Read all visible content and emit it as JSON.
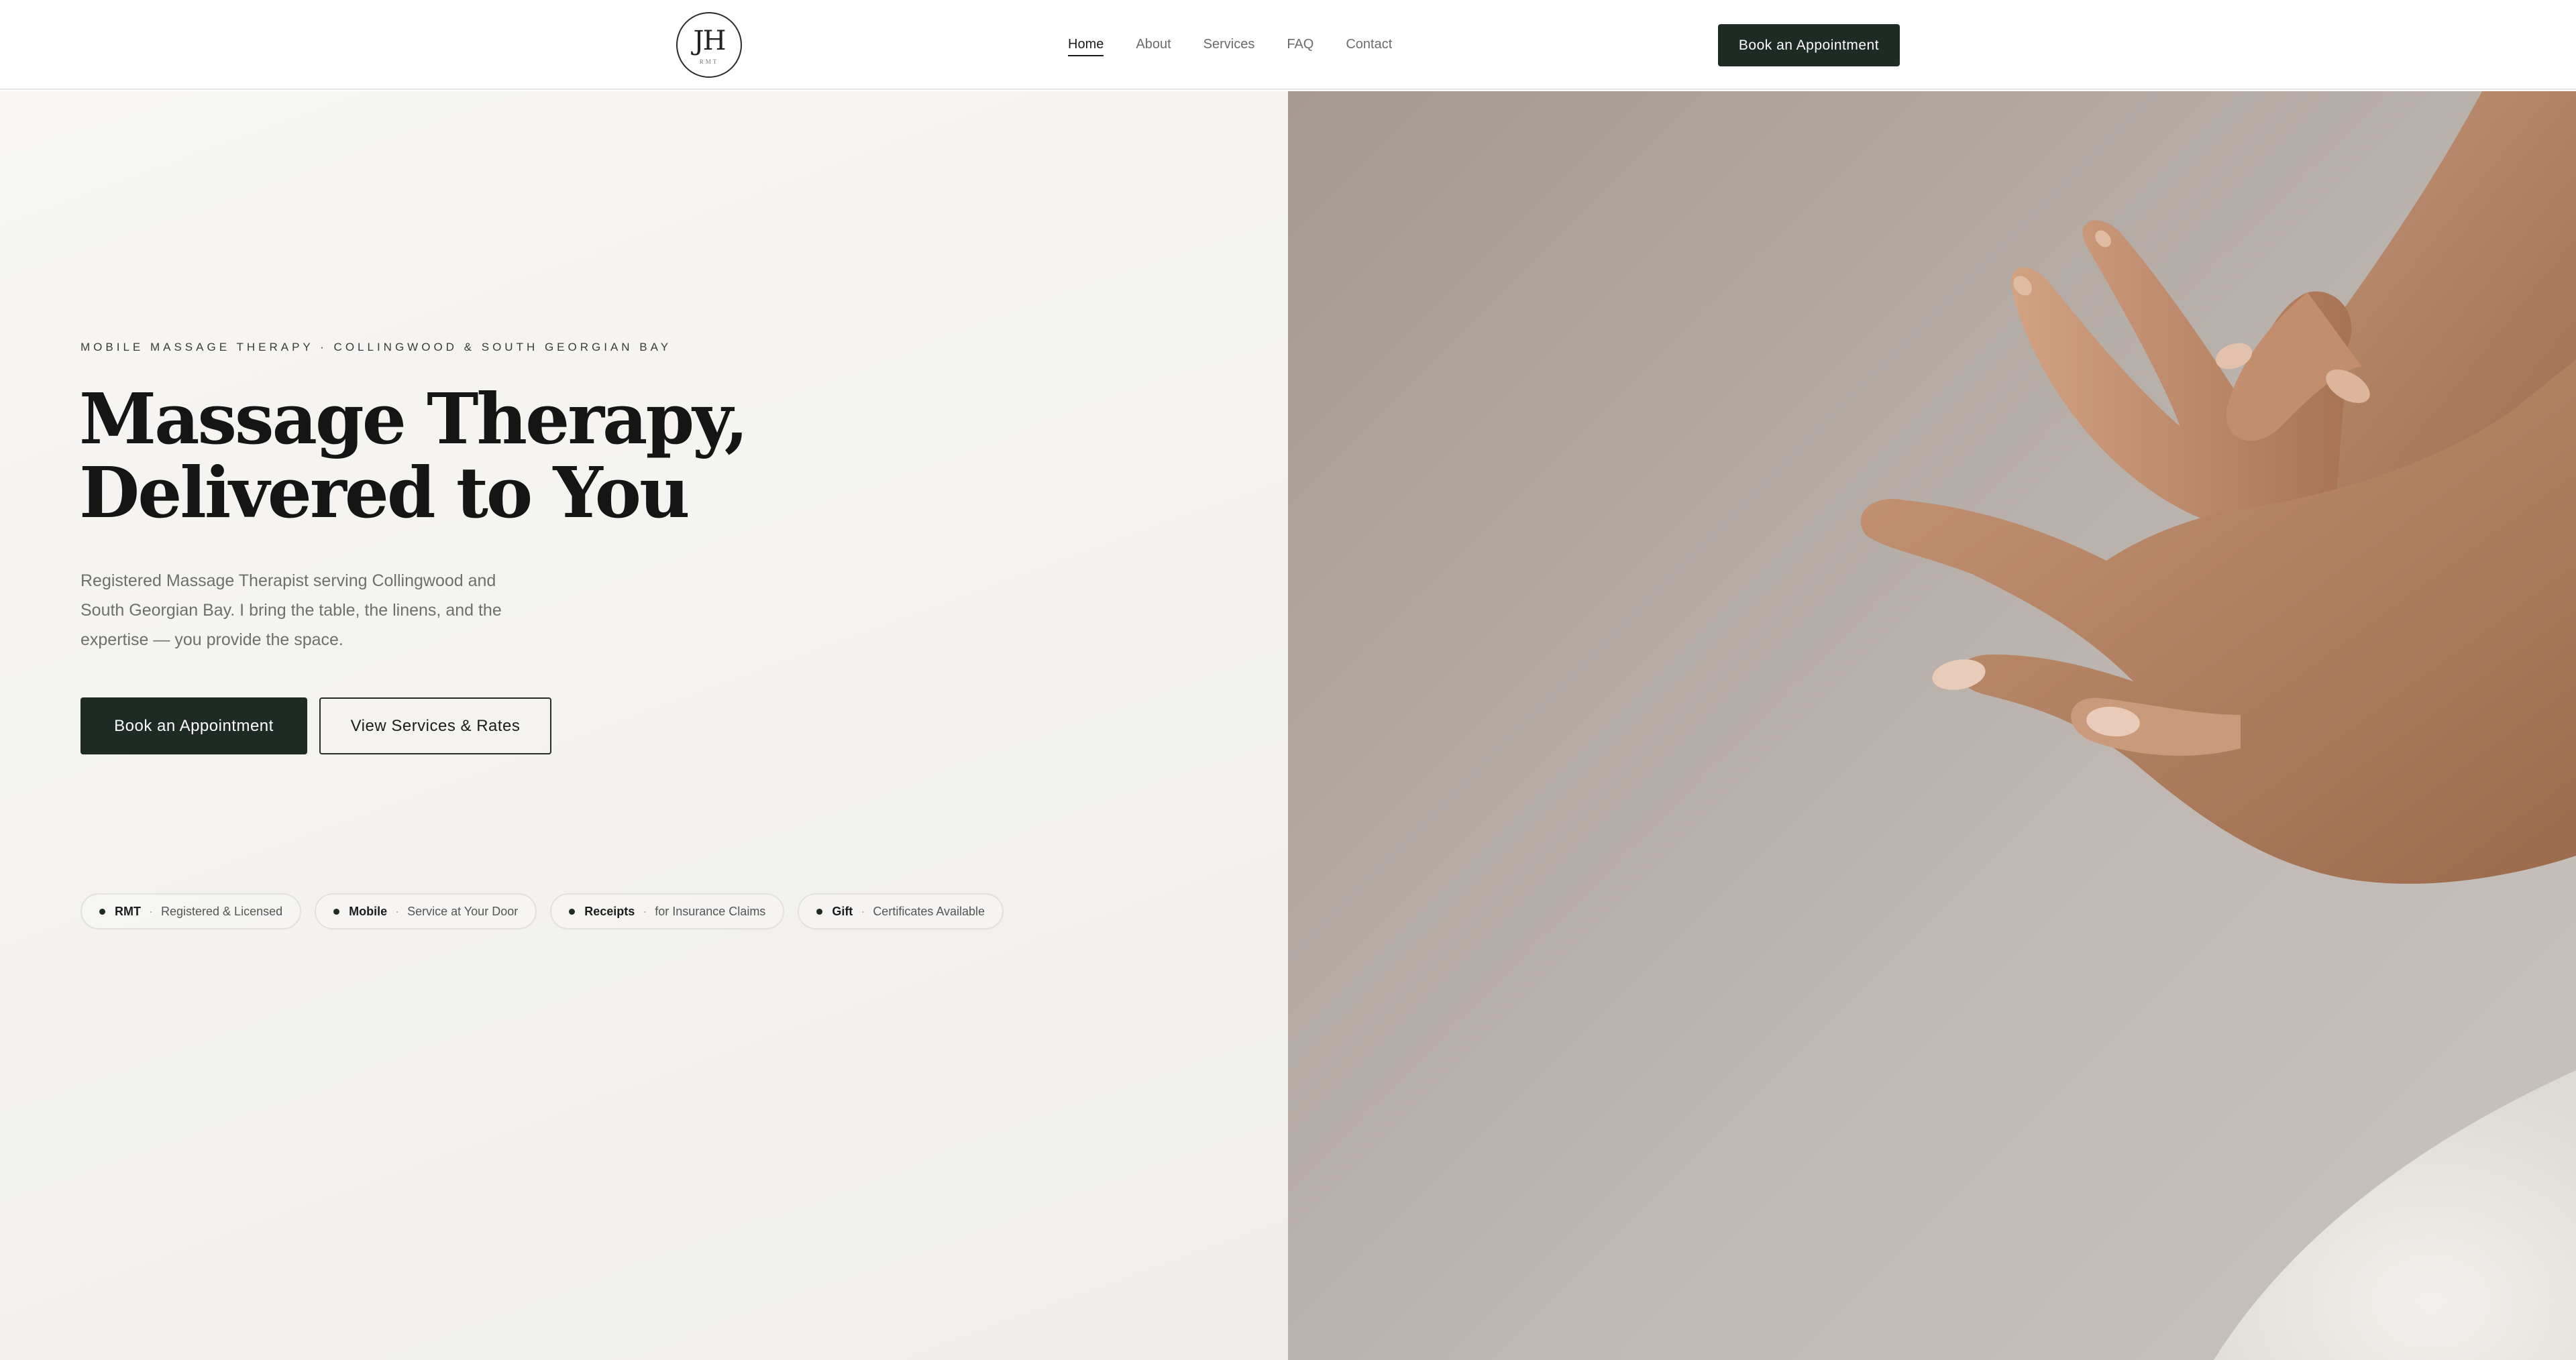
{
  "header": {
    "logo": {
      "monogram": "JH",
      "subtext": "RMT"
    },
    "nav": [
      {
        "label": "Home",
        "active": true
      },
      {
        "label": "About",
        "active": false
      },
      {
        "label": "Services",
        "active": false
      },
      {
        "label": "FAQ",
        "active": false
      },
      {
        "label": "Contact",
        "active": false
      }
    ],
    "cta_label": "Book an Appointment"
  },
  "hero": {
    "eyebrow": "MOBILE MASSAGE THERAPY · COLLINGWOOD & SOUTH GEORGIAN BAY",
    "headline_line1": "Massage Therapy,",
    "headline_line2": "Delivered to You",
    "lede": "Registered Massage Therapist serving Collingwood and South Georgian Bay. I bring the table, the linens, and the expertise — you provide the space.",
    "primary_cta": "Book an Appointment",
    "secondary_cta": "View Services & Rates",
    "badges": [
      {
        "strong": "RMT",
        "text": "Registered & Licensed"
      },
      {
        "strong": "Mobile",
        "text": "Service at Your Door"
      },
      {
        "strong": "Receipts",
        "text": "for Insurance Claims"
      },
      {
        "strong": "Gift",
        "text": "Certificates Available"
      }
    ],
    "image": {
      "subject": "massage-hands-photo"
    }
  },
  "colors": {
    "accent_dark_green": "#1d2b24",
    "hero_bg": "#f5f4f1",
    "text_primary": "#151515",
    "text_muted": "#6f6f6f"
  }
}
